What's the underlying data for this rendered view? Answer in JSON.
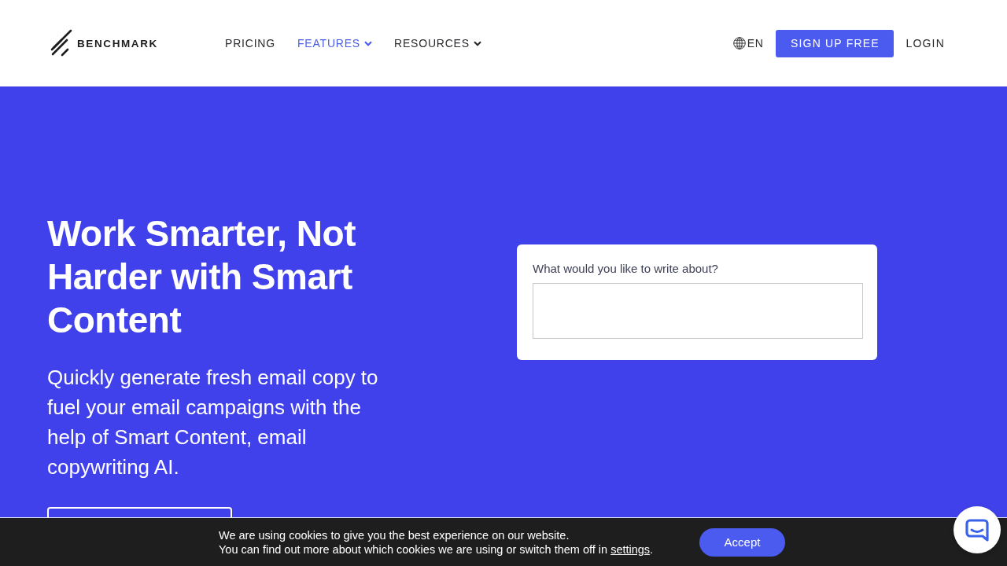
{
  "header": {
    "logo": "BENCHMARK",
    "nav": [
      {
        "label": "PRICING",
        "selected": false,
        "dropdown": false
      },
      {
        "label": "FEATURES",
        "selected": true,
        "dropdown": true
      },
      {
        "label": "RESOURCES",
        "selected": false,
        "dropdown": true
      }
    ],
    "language": "EN",
    "signup_button": "SIGN UP FREE",
    "login": "LOGIN"
  },
  "hero": {
    "title": "Work Smarter, Not Harder with Smart Content",
    "description": "Quickly generate fresh email copy to fuel your email campaigns with the help of Smart Content, email copywriting AI.",
    "demo_card": {
      "label": "What would you like to write about?"
    }
  },
  "cookie_bar": {
    "lines": [
      "We are using cookies to give you the best experience on our website.",
      "You can find out more about which cookies we are using or switch them off in"
    ],
    "link": "settings",
    "after_link": ".",
    "accept_button": "Accept"
  }
}
